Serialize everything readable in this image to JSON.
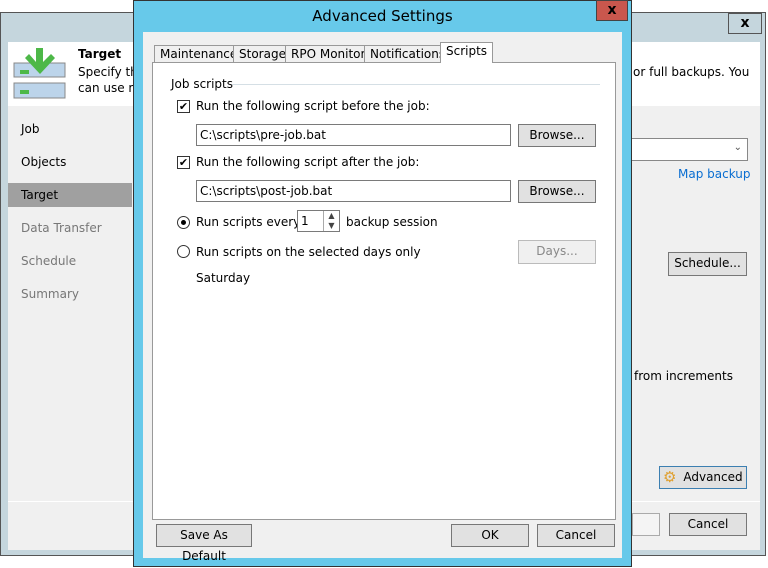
{
  "background_window": {
    "header": {
      "title": "Target",
      "desc_line1": "Specify the",
      "desc_line2": "can use m",
      "desc_tail": "or full backups. You"
    },
    "nav": [
      {
        "label": "Job"
      },
      {
        "label": "Objects"
      },
      {
        "label": "Target"
      },
      {
        "label": "Data Transfer"
      },
      {
        "label": "Schedule"
      },
      {
        "label": "Summary"
      }
    ],
    "map_backup": "Map backup",
    "schedule_button": "Schedule...",
    "increments_text": "from increments",
    "advanced_button": "Advanced",
    "cancel_button": "Cancel",
    "close": "x"
  },
  "dialog": {
    "title": "Advanced Settings",
    "close": "x",
    "tabs": [
      {
        "label": "Maintenance"
      },
      {
        "label": "Storage"
      },
      {
        "label": "RPO Monitor"
      },
      {
        "label": "Notifications"
      },
      {
        "label": "Scripts"
      }
    ],
    "group_title": "Job scripts",
    "before_label": "Run the following script before the job:",
    "before_checked": true,
    "before_path": "C:\\scripts\\pre-job.bat",
    "after_label": "Run the following script after the job:",
    "after_checked": true,
    "after_path": "C:\\scripts\\post-job.bat",
    "browse": "Browse...",
    "every_label": "Run scripts every",
    "every_value": "1",
    "every_suffix": "backup session",
    "days_label": "Run scripts on the selected days only",
    "days_button": "Days...",
    "days_value": "Saturday",
    "save_default": "Save As Default",
    "ok": "OK",
    "cancel": "Cancel"
  }
}
